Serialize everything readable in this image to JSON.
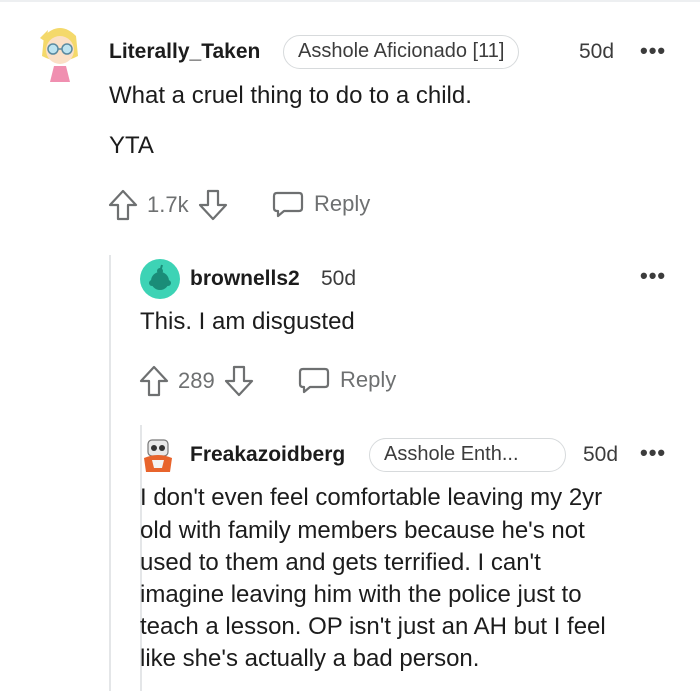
{
  "comments": [
    {
      "username": "Literally_Taken",
      "flair": "Asshole Aficionado [11]",
      "age": "50d",
      "lines": [
        "What a cruel thing to do to a child.",
        "YTA"
      ],
      "score": "1.7k",
      "reply_label": "Reply"
    },
    {
      "username": "brownells2",
      "age": "50d",
      "text": "This. I am disgusted",
      "score": "289",
      "reply_label": "Reply"
    },
    {
      "username": "Freakazoidberg",
      "flair": "Asshole Enth...",
      "age": "50d",
      "lines": [
        "I don't even feel comfortable leaving my 2yr",
        "old with family members because he's not",
        "used to them and gets terrified. I can't",
        "imagine leaving him with the police just to",
        "teach a lesson. OP isn't just an AH but I feel",
        "like she's actually a bad person."
      ]
    }
  ],
  "more_label": "•••",
  "colors": {
    "text": "#1c1c1c",
    "meta": "#3c3c3c",
    "action": "#6e7071",
    "flair_border": "#d7dadc",
    "thread_line": "#e4e6e8",
    "snoo_teal": "#3dd3b5"
  },
  "icons": [
    "upvote-icon",
    "downvote-icon",
    "reply-bubble-icon",
    "more-options-icon"
  ]
}
